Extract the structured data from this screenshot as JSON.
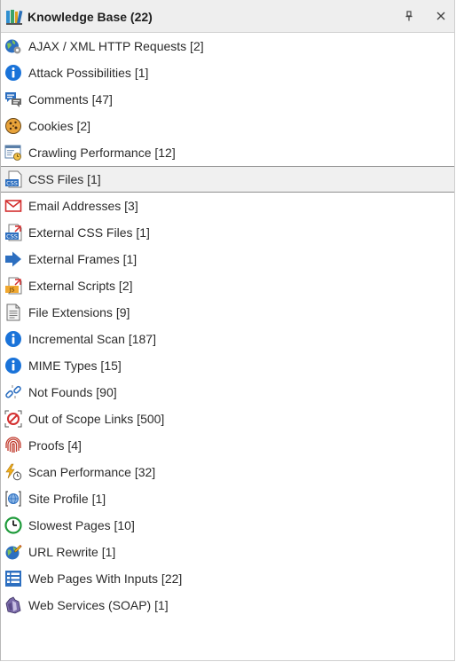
{
  "panel": {
    "title": "Knowledge Base (22)",
    "pin_icon": "pin-icon",
    "close_icon": "close-icon",
    "title_icon": "books-icon"
  },
  "items": [
    {
      "label": "AJAX / XML HTTP Requests [2]",
      "icon": "globe-gear-icon"
    },
    {
      "label": "Attack Possibilities [1]",
      "icon": "info-icon"
    },
    {
      "label": "Comments [47]",
      "icon": "comments-icon"
    },
    {
      "label": "Cookies [2]",
      "icon": "cookie-icon"
    },
    {
      "label": "Crawling Performance [12]",
      "icon": "crawling-performance-icon"
    },
    {
      "label": "CSS Files [1]",
      "icon": "css-file-icon",
      "selected": true
    },
    {
      "label": "Email Addresses [3]",
      "icon": "envelope-icon"
    },
    {
      "label": "External CSS Files [1]",
      "icon": "external-css-icon"
    },
    {
      "label": "External Frames [1]",
      "icon": "arrow-right-icon"
    },
    {
      "label": "External Scripts [2]",
      "icon": "external-js-icon"
    },
    {
      "label": "File Extensions [9]",
      "icon": "document-icon"
    },
    {
      "label": "Incremental Scan [187]",
      "icon": "info-icon"
    },
    {
      "label": "MIME Types [15]",
      "icon": "info-icon"
    },
    {
      "label": "Not Founds [90]",
      "icon": "broken-link-icon"
    },
    {
      "label": "Out of Scope Links [500]",
      "icon": "out-of-scope-icon"
    },
    {
      "label": "Proofs [4]",
      "icon": "fingerprint-icon"
    },
    {
      "label": "Scan Performance [32]",
      "icon": "lightning-timer-icon"
    },
    {
      "label": "Site Profile [1]",
      "icon": "site-profile-icon"
    },
    {
      "label": "Slowest Pages [10]",
      "icon": "clock-icon"
    },
    {
      "label": "URL Rewrite [1]",
      "icon": "globe-pencil-icon"
    },
    {
      "label": "Web Pages With Inputs [22]",
      "icon": "form-list-icon"
    },
    {
      "label": "Web Services (SOAP) [1]",
      "icon": "soap-bottle-icon"
    }
  ],
  "colors": {
    "info_blue": "#1a73d9",
    "selected_bg": "#f0f0f0",
    "titlebar_bg": "#eeeeee"
  }
}
